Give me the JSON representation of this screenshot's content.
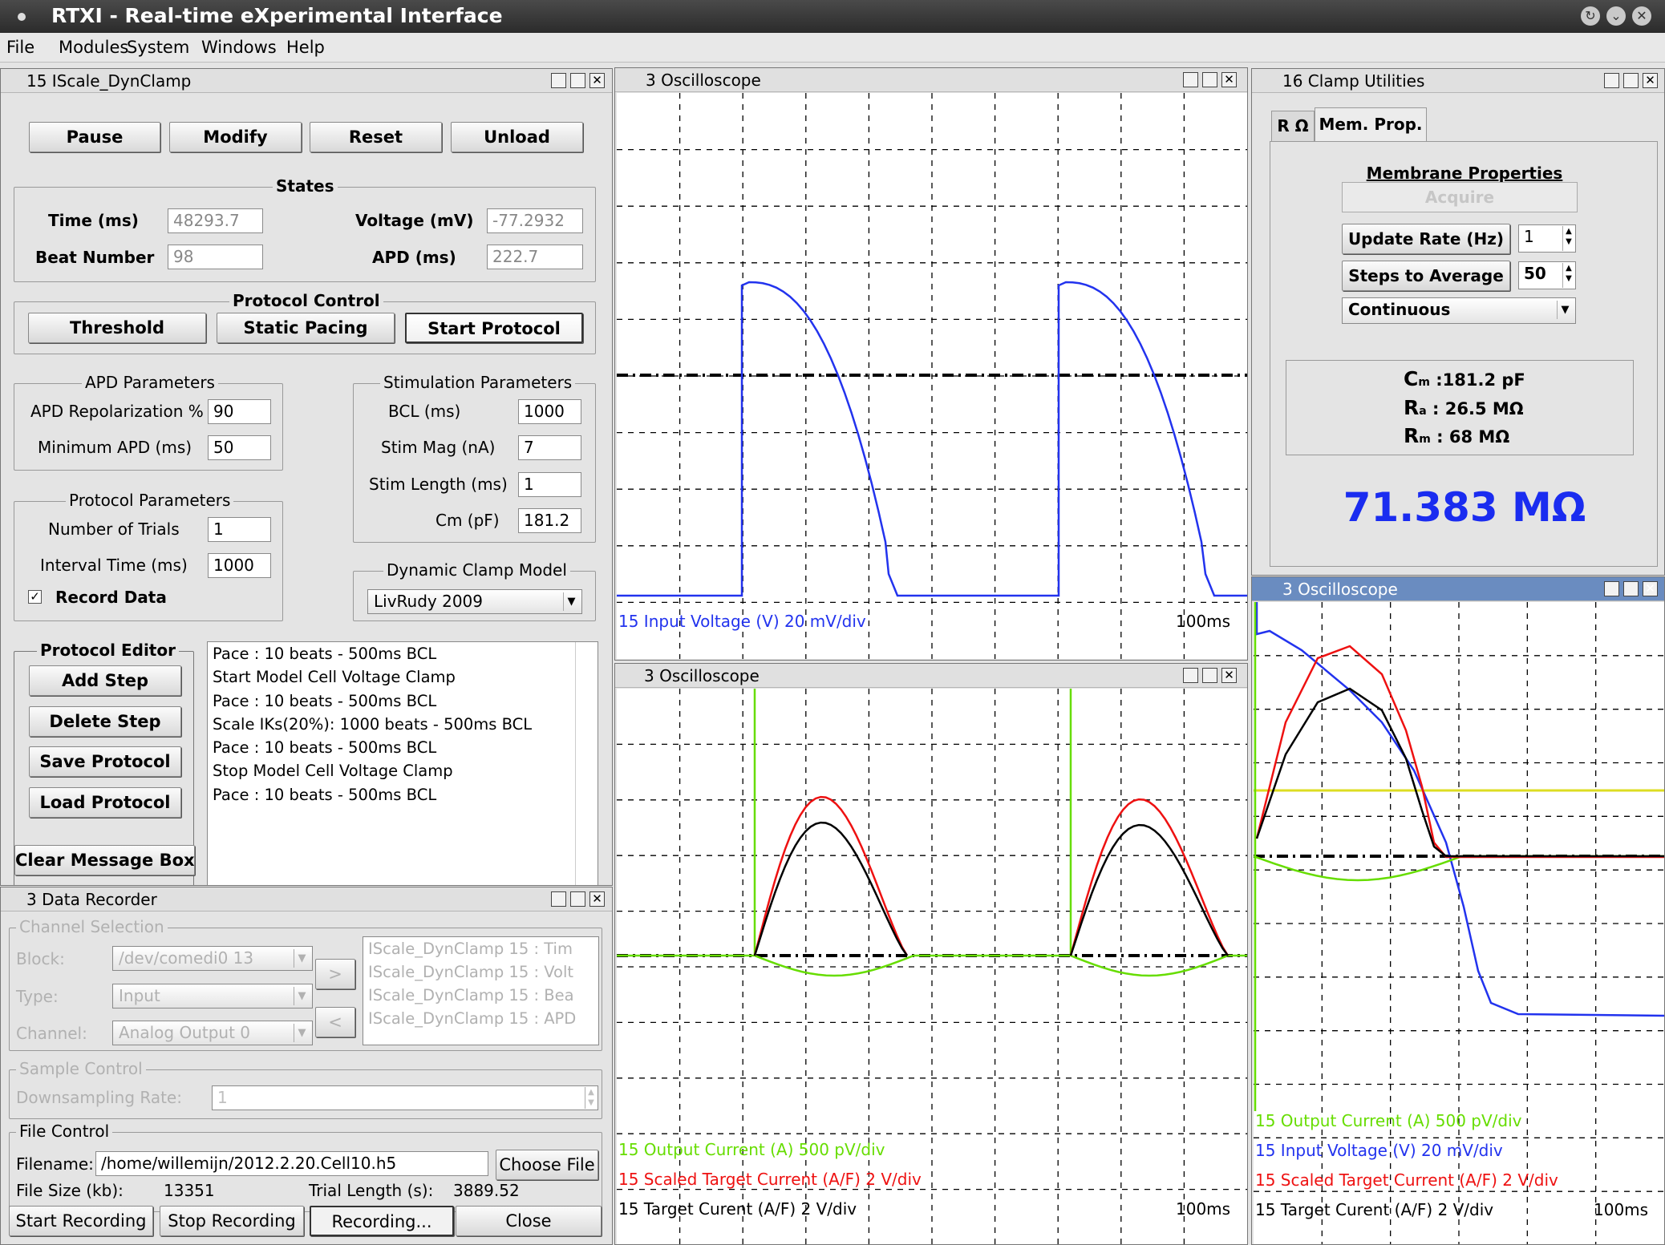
{
  "app": {
    "title": "RTXI - Real-time eXperimental Interface",
    "win_controls": [
      "restore-icon",
      "minimize-icon",
      "close-icon"
    ]
  },
  "menu": [
    "File",
    "Modules",
    "System",
    "Windows",
    "Help"
  ],
  "iscale": {
    "title": "15 IScale_DynClamp",
    "buttons": [
      "Pause",
      "Modify",
      "Reset",
      "Unload"
    ],
    "states": {
      "title": "States",
      "time_label": "Time (ms)",
      "time_value": "48293.7",
      "voltage_label": "Voltage (mV)",
      "voltage_value": "-77.2932",
      "beat_label": "Beat Number",
      "beat_value": "98",
      "apd_label": "APD (ms)",
      "apd_value": "222.7"
    },
    "protocol_control": {
      "title": "Protocol Control",
      "buttons": [
        "Threshold",
        "Static Pacing",
        "Start Protocol"
      ]
    },
    "apd_params": {
      "title": "APD Parameters",
      "repol_label": "APD Repolarization %",
      "repol_value": "90",
      "min_label": "Minimum APD (ms)",
      "min_value": "50"
    },
    "stim_params": {
      "title": "Stimulation Parameters",
      "rows": [
        {
          "label": "BCL (ms)",
          "value": "1000"
        },
        {
          "label": "Stim Mag (nA)",
          "value": "7"
        },
        {
          "label": "Stim Length (ms)",
          "value": "1"
        },
        {
          "label": "Cm (pF)",
          "value": "181.2"
        }
      ]
    },
    "protocol_params": {
      "title": "Protocol Parameters",
      "trials_label": "Number of Trials",
      "trials_value": "1",
      "interval_label": "Interval Time (ms)",
      "interval_value": "1000",
      "record_label": "Record Data",
      "record_checked": true,
      "check_mark": "✓"
    },
    "model": {
      "title": "Dynamic Clamp Model",
      "value": "LivRudy 2009"
    },
    "editor": {
      "title": "Protocol Editor",
      "buttons": [
        "Add Step",
        "Delete Step",
        "Save Protocol",
        "Load Protocol"
      ],
      "clear_label": "Clear Message Box"
    },
    "steps": [
      "Pace : 10 beats - 500ms BCL",
      "Start Model Cell Voltage Clamp",
      "Pace : 10 beats - 500ms BCL",
      "Scale IKs(20%): 1000 beats - 500ms BCL",
      "Pace : 10 beats - 500ms BCL",
      "Stop Model Cell Voltage Clamp",
      "Pace : 10 beats - 500ms BCL"
    ]
  },
  "recorder": {
    "title": "3 Data Recorder",
    "channel_selection": {
      "title": "Channel Selection",
      "block_label": "Block:",
      "block_value": "/dev/comedi0 13",
      "type_label": "Type:",
      "type_value": "Input",
      "channel_label": "Channel:",
      "channel_value": "Analog Output 0",
      "add_arrow": ">",
      "remove_arrow": "<",
      "list": [
        "IScale_DynClamp 15 : Tim",
        "IScale_DynClamp 15 : Volt",
        "IScale_DynClamp 15 : Bea",
        "IScale_DynClamp 15 : APD"
      ]
    },
    "sample_control": {
      "title": "Sample Control",
      "downsample_label": "Downsampling Rate:",
      "downsample_value": "1"
    },
    "file_control": {
      "title": "File Control",
      "filename_label": "Filename:",
      "filename_value": "/home/willemijn/2012.2.20.Cell10.h5",
      "choose_label": "Choose File",
      "size_label": "File Size (kb):",
      "size_value": "13351",
      "trial_label": "Trial Length (s):",
      "trial_value": "3889.52"
    },
    "buttons": [
      "Start Recording",
      "Stop Recording",
      "Recording...",
      "Close"
    ]
  },
  "osc1": {
    "title": "3 Oscilloscope",
    "legend": [
      "15 Input Voltage (V) 20 mV/div"
    ],
    "legend_colors": [
      "#2233ee"
    ],
    "time": "100ms"
  },
  "osc2": {
    "title": "3 Oscilloscope",
    "legend": [
      "15 Output Current (A) 500 pV/div",
      "15 Scaled Target Current (A/F) 2 V/div",
      "15 Target Curent (A/F) 2 V/div"
    ],
    "legend_colors": [
      "#66dd00",
      "#ee1111",
      "#000000"
    ],
    "time": "100ms"
  },
  "osc3": {
    "title": "3 Oscilloscope",
    "legend": [
      "15 Output Current (A) 500 pV/div",
      "15 Input Voltage (V) 20 mV/div",
      "15 Scaled Target Current (A/F) 2 V/div",
      "15 Target Curent (A/F) 2 V/div"
    ],
    "legend_colors": [
      "#66dd00",
      "#2233ee",
      "#ee1111",
      "#000000"
    ],
    "time": "100ms"
  },
  "clamp": {
    "title": "16 Clamp Utilities",
    "tabs": [
      "R Ω",
      "Mem. Prop."
    ],
    "heading": "Membrane Properties",
    "acquire_label": "Acquire",
    "update_label": "Update Rate (Hz)",
    "update_value": "1",
    "steps_label": "Steps to Average",
    "steps_value": "50",
    "mode_value": "Continuous",
    "cm_sym": "C",
    "cm_sub": "m",
    "cm_value": ":181.2 pF",
    "ra_sym": "R",
    "ra_sub": "a",
    "ra_value": ": 26.5 MΩ",
    "rm_sym": "R",
    "rm_sub": "m",
    "rm_value": ":  68 MΩ",
    "resistance": "71.383 MΩ",
    "resistance_color": "#1a2cf0"
  }
}
